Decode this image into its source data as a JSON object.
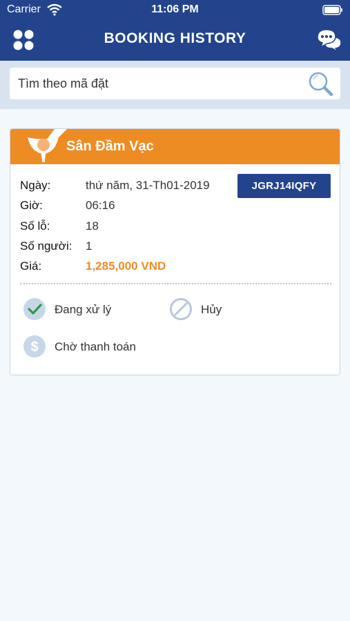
{
  "status_bar": {
    "carrier": "Carrier",
    "time": "11:06 PM"
  },
  "header": {
    "title": "BOOKING HISTORY",
    "menu_icon": "grid-menu-icon",
    "chat_icon": "chat-bubbles-icon"
  },
  "search": {
    "placeholder": "Tìm theo mã đặt",
    "value": "",
    "icon": "search-icon"
  },
  "booking": {
    "course_name": "Sân Đầm Vạc",
    "code": "JGRJ14IQFY",
    "rows": [
      {
        "label": "Ngày:",
        "value": "thứ năm, 31-Th01-2019"
      },
      {
        "label": "Giờ:",
        "value": "06:16"
      },
      {
        "label": "Số lỗ:",
        "value": "18"
      },
      {
        "label": "Số người:",
        "value": "1"
      },
      {
        "label": "Giá:",
        "value": "1,285,000 VND"
      }
    ],
    "statuses": [
      {
        "label": "Đang xử lý",
        "icon": "check-circle-icon"
      },
      {
        "label": "Hủy",
        "icon": "cancel-circle-icon"
      },
      {
        "label": "Chờ thanh toán",
        "icon": "dollar-circle-icon"
      }
    ]
  },
  "colors": {
    "header": "#23448c",
    "accent": "#ee8c24",
    "background": "#f3f8fc"
  }
}
